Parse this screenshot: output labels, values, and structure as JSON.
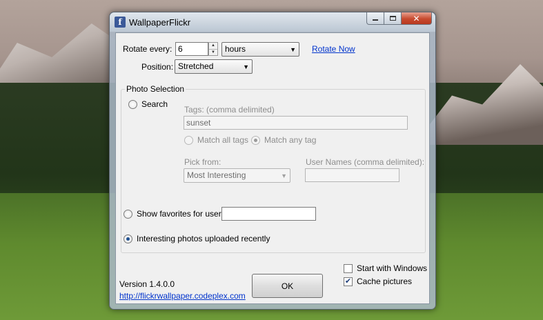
{
  "window": {
    "title": "WallpaperFlickr",
    "icon_letter": "f"
  },
  "rotate": {
    "label": "Rotate every:",
    "value": "6",
    "unit": "hours",
    "rotate_now_link": "Rotate Now"
  },
  "position": {
    "label": "Position:",
    "value": "Stretched"
  },
  "photo_selection": {
    "group_title": "Photo Selection",
    "search": {
      "label": "Search",
      "checked": false,
      "tags_label": "Tags:  (comma delimited)",
      "tags_value": "sunset",
      "match_all_label": "Match all tags",
      "match_any_label": "Match any tag",
      "match_mode": "any",
      "pick_from_label": "Pick from:",
      "pick_from_value": "Most Interesting",
      "user_names_label": "User Names (comma delimited):",
      "user_names_value": ""
    },
    "favorites": {
      "label": "Show favorites for user:",
      "value": ""
    },
    "interesting": {
      "label": "Interesting photos uploaded recently",
      "checked": true
    }
  },
  "footer": {
    "version": "Version 1.4.0.0",
    "site_link": "http://flickrwallpaper.codeplex.com",
    "ok_label": "OK",
    "start_with_windows_label": "Start with Windows",
    "start_with_windows_checked": false,
    "cache_pictures_label": "Cache pictures",
    "cache_pictures_checked": true
  },
  "icons": {
    "minimize": "minimize-icon",
    "maximize": "maximize-icon",
    "close": "close-icon",
    "dropdown": "chevron-down-icon"
  }
}
